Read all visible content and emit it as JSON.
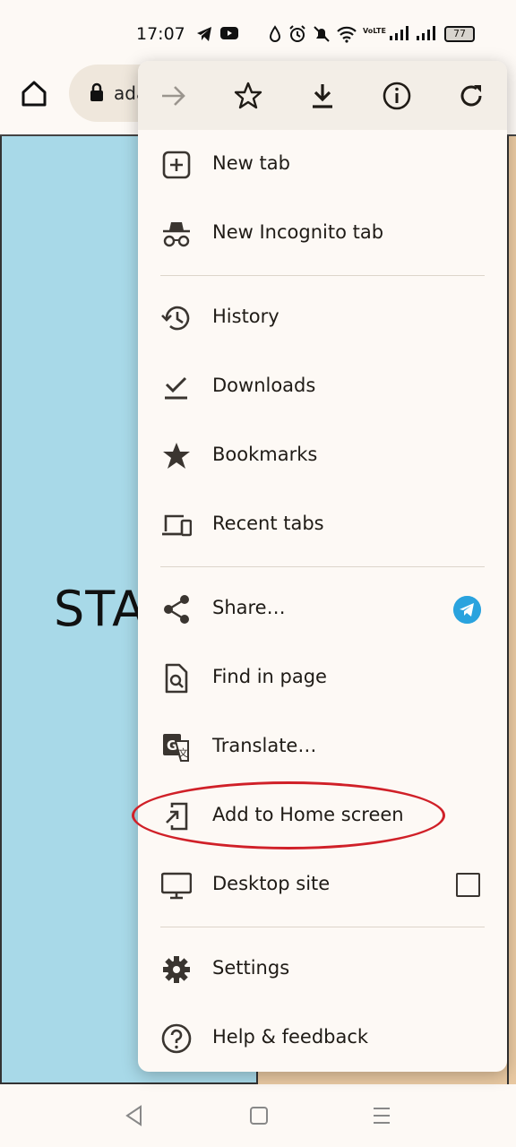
{
  "status_bar": {
    "time": "17:07",
    "network_label": "VoLTE",
    "battery": "77",
    "icons": [
      "telegram-icon",
      "youtube-icon",
      "drop-icon",
      "alarm-icon",
      "mute-icon",
      "wifi-icon",
      "signal-icon",
      "signal-icon",
      "battery-icon"
    ]
  },
  "toolbar": {
    "url_fragment": "ada"
  },
  "page": {
    "partial_text": "STA"
  },
  "menu": {
    "top_actions": [
      "forward-icon",
      "bookmark-star-icon",
      "download-icon",
      "info-icon",
      "reload-icon"
    ],
    "items": [
      {
        "label": "New tab",
        "icon": "new-tab-icon"
      },
      {
        "label": "New Incognito tab",
        "icon": "incognito-icon"
      },
      {
        "label": "History",
        "icon": "history-icon"
      },
      {
        "label": "Downloads",
        "icon": "downloads-icon"
      },
      {
        "label": "Bookmarks",
        "icon": "bookmarks-icon"
      },
      {
        "label": "Recent tabs",
        "icon": "recent-tabs-icon"
      },
      {
        "label": "Share…",
        "icon": "share-icon"
      },
      {
        "label": "Find in page",
        "icon": "find-in-page-icon"
      },
      {
        "label": "Translate…",
        "icon": "translate-icon"
      },
      {
        "label": "Add to Home screen",
        "icon": "add-to-home-icon"
      },
      {
        "label": "Desktop site",
        "icon": "desktop-icon"
      },
      {
        "label": "Settings",
        "icon": "settings-icon"
      },
      {
        "label": "Help & feedback",
        "icon": "help-icon"
      }
    ],
    "desktop_site_checked": false
  },
  "annotation": {
    "color": "#d02028",
    "target": "Add to Home screen"
  },
  "colors": {
    "menu_bg": "#fdf9f5",
    "page_blue": "#a8d9e8",
    "page_tan": "#e9c9a2",
    "telegram_blue": "#2aa3de"
  }
}
